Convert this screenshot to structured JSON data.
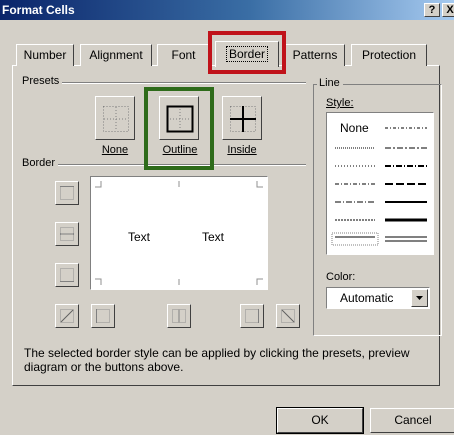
{
  "window": {
    "title": "Format Cells",
    "help_glyph": "?",
    "close_glyph": "X"
  },
  "tabs": [
    {
      "label": "Number"
    },
    {
      "label": "Alignment"
    },
    {
      "label": "Font"
    },
    {
      "label": "Border",
      "active": true
    },
    {
      "label": "Patterns"
    },
    {
      "label": "Protection"
    }
  ],
  "presets": {
    "group_label": "Presets",
    "items": [
      {
        "label": "None",
        "icon": "preset-none-icon"
      },
      {
        "label": "Outline",
        "icon": "preset-outline-icon"
      },
      {
        "label": "Inside",
        "icon": "preset-inside-icon"
      }
    ]
  },
  "border": {
    "group_label": "Border",
    "preview_text_left": "Text",
    "preview_text_right": "Text"
  },
  "line": {
    "group_label": "Line",
    "style_label": "Style:",
    "style_none": "None",
    "color_label": "Color:",
    "color_value": "Automatic"
  },
  "description": "The selected border style can be applied by clicking the presets, preview diagram or the buttons above.",
  "buttons": {
    "ok": "OK",
    "cancel": "Cancel"
  },
  "highlights": {
    "tab_color": "#c0121a",
    "preset_color": "#2e6b1a"
  }
}
